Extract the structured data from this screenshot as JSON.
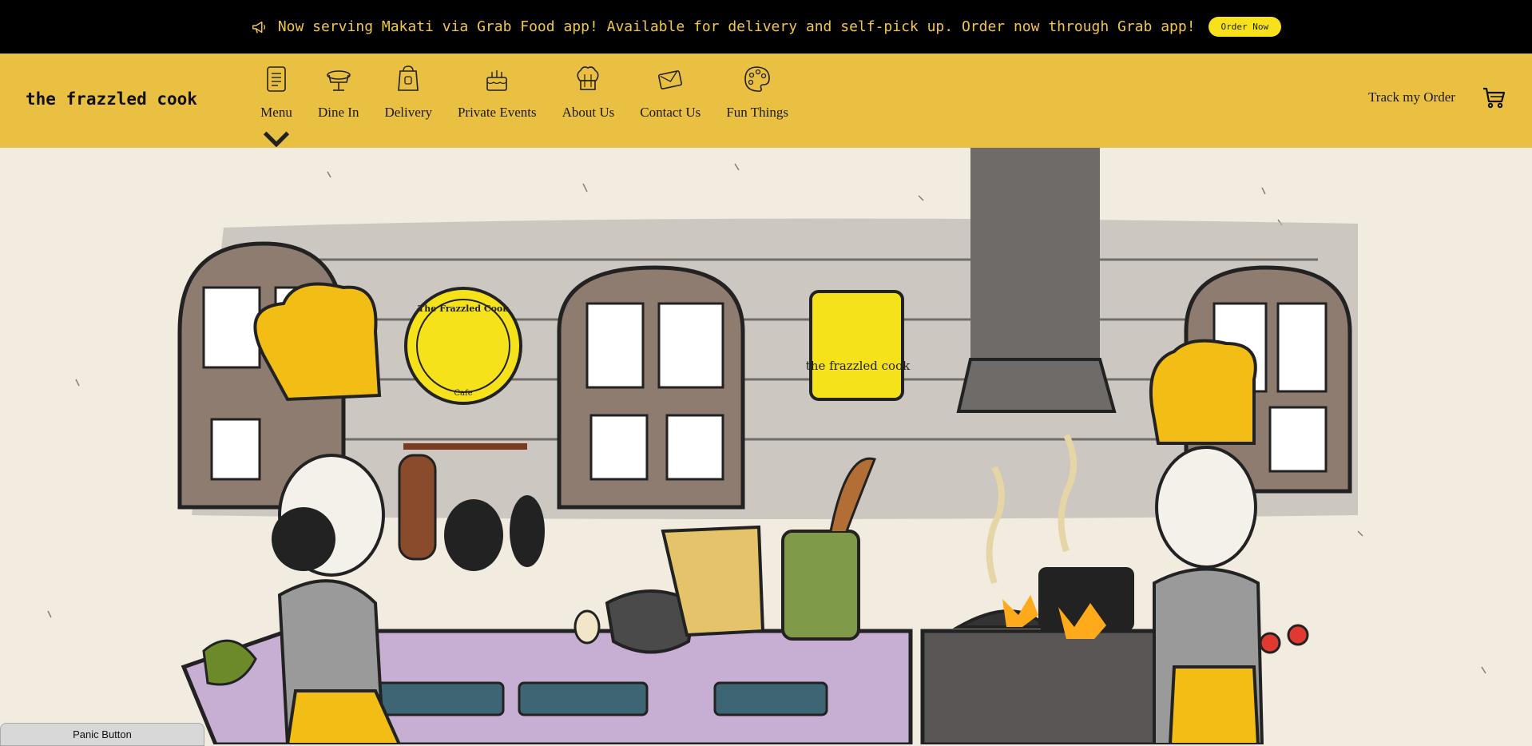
{
  "announcement": {
    "icon": "megaphone-icon",
    "text": "Now serving Makati via Grab Food app! Available for delivery and self-pick up. Order now through Grab app!",
    "button_label": "Order Now",
    "background": "#000000",
    "text_color": "#f2c744",
    "button_color": "#f7e11a"
  },
  "header": {
    "brand": "the frazzled cook",
    "background": "#e9c042",
    "nav": [
      {
        "label": "Menu",
        "icon": "menu-book-icon",
        "has_dropdown": true
      },
      {
        "label": "Dine In",
        "icon": "dining-table-icon"
      },
      {
        "label": "Delivery",
        "icon": "takeout-bag-icon"
      },
      {
        "label": "Private Events",
        "icon": "cake-icon"
      },
      {
        "label": "About Us",
        "icon": "chef-hat-icon"
      },
      {
        "label": "Contact Us",
        "icon": "letter-icon"
      },
      {
        "label": "Fun Things",
        "icon": "palette-icon"
      }
    ],
    "track_order": "Track my Order",
    "cart_icon": "shopping-cart-icon"
  },
  "hero": {
    "illustration": "kitchen-illustration",
    "logo_round": {
      "line1": "The Frazzled Cook",
      "line2": "Cafe"
    },
    "logo_square": "the frazzled cook"
  },
  "panic_button": "Panic Button"
}
